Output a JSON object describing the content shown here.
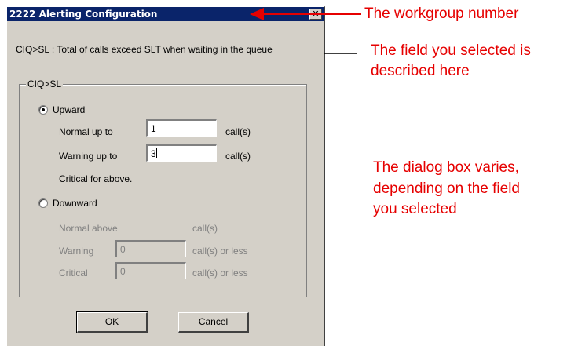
{
  "dialog": {
    "title": "2222 Alerting Configuration",
    "close_glyph": "✕",
    "description": "CIQ>SL : Total of calls exceed SLT when waiting in the queue",
    "group_label": "CIQ>SL",
    "upward": {
      "label": "Upward",
      "selected": true,
      "normal_label": "Normal up to",
      "normal_value": "1",
      "warning_label": "Warning up to",
      "warning_value": "3",
      "unit": "call(s)",
      "critical_text": "Critical for above."
    },
    "downward": {
      "label": "Downward",
      "selected": false,
      "normal_label": "Normal above",
      "normal_unit": "call(s)",
      "warning_label": "Warning",
      "warning_value": "0",
      "warning_unit": "call(s) or less",
      "critical_label": "Critical",
      "critical_value": "0",
      "critical_unit": "call(s) or less"
    },
    "ok_label": "OK",
    "cancel_label": "Cancel"
  },
  "annotations": {
    "workgroup": "The workgroup number",
    "field_line1": "The field you selected is",
    "field_line2": "described here",
    "varies_line1": "The dialog box varies,",
    "varies_line2": "depending on the field",
    "varies_line3": "you selected"
  },
  "colors": {
    "annotation": "#e60000",
    "titlebar": "#0a246a",
    "dialog_bg": "#d4d0c8"
  }
}
